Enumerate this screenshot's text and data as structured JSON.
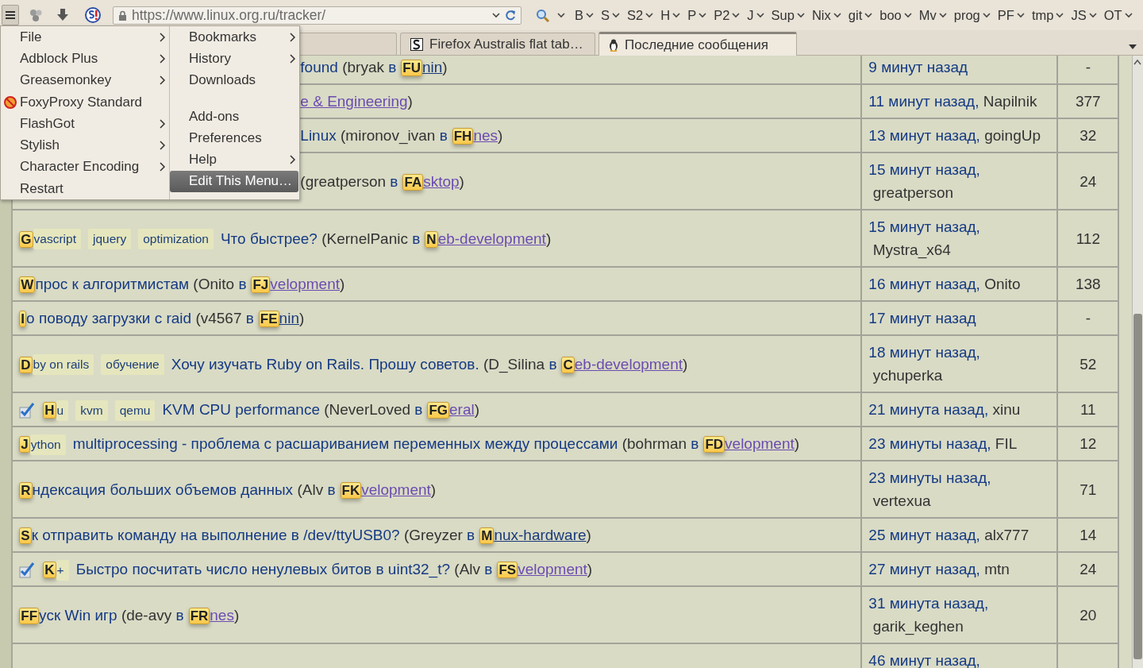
{
  "toolbar": {
    "url": "https://www.linux.org.ru/tracker/",
    "bookmarks": [
      "B",
      "S",
      "S2",
      "H",
      "P",
      "P2",
      "J",
      "Sup",
      "Nix",
      "git",
      "boo",
      "Mv",
      "prog",
      "PF",
      "tmp",
      "JS",
      "OT"
    ]
  },
  "tabs": [
    {
      "selected": false
    },
    {
      "label": "Firefox Australis flat tab…",
      "selected": false
    },
    {
      "label": "Последние сообщения",
      "selected": true
    }
  ],
  "menu": {
    "columns": [
      {
        "items": [
          {
            "kind": "plain",
            "label": "File",
            "submenu": true,
            "highlighted": false
          },
          {
            "kind": "plain",
            "label": "Adblock Plus",
            "submenu": true,
            "highlighted": false
          },
          {
            "kind": "plain",
            "label": "Greasemonkey",
            "submenu": true,
            "highlighted": false
          },
          {
            "kind": "iconic",
            "label": "FoxyProxy Standard",
            "submenu": false,
            "highlighted": false
          },
          {
            "kind": "plain",
            "label": "FlashGot",
            "submenu": true,
            "highlighted": false
          },
          {
            "kind": "plain",
            "label": "Stylish",
            "submenu": true,
            "highlighted": false
          },
          {
            "kind": "plain",
            "label": "Character Encoding",
            "submenu": true,
            "highlighted": false
          },
          {
            "kind": "plain",
            "label": "Restart",
            "submenu": false,
            "highlighted": false
          }
        ]
      },
      {
        "items": [
          {
            "kind": "plain",
            "label": "Bookmarks",
            "submenu": true,
            "highlighted": false
          },
          {
            "kind": "plain",
            "label": "History",
            "submenu": true,
            "highlighted": false
          },
          {
            "kind": "plain",
            "label": "Downloads",
            "submenu": false,
            "highlighted": false
          },
          {
            "kind": "gap"
          },
          {
            "kind": "plain",
            "label": "Add-ons",
            "submenu": false,
            "highlighted": false
          },
          {
            "kind": "plain",
            "label": "Preferences",
            "submenu": false,
            "highlighted": false
          },
          {
            "kind": "plain",
            "label": "Help",
            "submenu": true,
            "highlighted": false
          },
          {
            "kind": "plain",
            "label": "Edit This Menu…",
            "submenu": false,
            "highlighted": true
          }
        ]
      }
    ]
  },
  "table": {
    "rows": [
      {
        "checked": false,
        "parts": [
          {
            "kind": "topic",
            "text": "found"
          },
          {
            "kind": "text",
            "text": " (bryak "
          },
          {
            "kind": "in",
            "text": "в"
          },
          {
            "kind": "hint",
            "text": "FU"
          },
          {
            "kind": "section",
            "text": "nin",
            "visited": false
          },
          {
            "kind": "text",
            "text": ")"
          }
        ],
        "ago": "9 минут назад",
        "count": "-"
      },
      {
        "checked": false,
        "parts": [
          {
            "kind": "section",
            "text": "e & Engineering",
            "visited": true
          },
          {
            "kind": "text",
            "text": ")"
          }
        ],
        "ago": "11 минут назад,",
        "author": "Napilnik",
        "count": "377"
      },
      {
        "checked": false,
        "parts": [
          {
            "kind": "topic",
            "text": "Linux"
          },
          {
            "kind": "text",
            "text": " (mironov_ivan "
          },
          {
            "kind": "in",
            "text": "в"
          },
          {
            "kind": "hint",
            "text": "FH"
          },
          {
            "kind": "section",
            "text": "nes",
            "visited": true
          },
          {
            "kind": "text",
            "text": ")"
          }
        ],
        "ago": "13 минут назад,",
        "author": "goingUp",
        "count": "32"
      },
      {
        "checked": false,
        "parts": [
          {
            "kind": "text",
            "text": "(greatperson "
          },
          {
            "kind": "in",
            "text": "в"
          },
          {
            "kind": "hint",
            "text": "FA"
          },
          {
            "kind": "section",
            "text": "sktop",
            "visited": true
          },
          {
            "kind": "text",
            "text": ")"
          }
        ],
        "ago": "15 минут назад,",
        "author": "greatperson",
        "count": "24"
      },
      {
        "checked": false,
        "parts": [
          {
            "kind": "hint",
            "text": "G"
          },
          {
            "kind": "tag",
            "text": "vascript"
          },
          {
            "kind": "tag",
            "text": "jquery"
          },
          {
            "kind": "tag",
            "text": "optimization"
          },
          {
            "kind": "topic",
            "text": "Что быстрее?"
          },
          {
            "kind": "text",
            "text": " (KernelPanic "
          },
          {
            "kind": "in",
            "text": "в"
          },
          {
            "kind": "hint",
            "text": "N"
          },
          {
            "kind": "section",
            "text": "eb-development",
            "visited": true
          },
          {
            "kind": "text",
            "text": ")"
          }
        ],
        "ago": "15 минут назад,",
        "author": "Mystra_x64",
        "count": "112"
      },
      {
        "checked": false,
        "parts": [
          {
            "kind": "hint",
            "text": "W"
          },
          {
            "kind": "topic",
            "text": "прос к алгоритмистам"
          },
          {
            "kind": "text",
            "text": " (Onito "
          },
          {
            "kind": "in",
            "text": "в"
          },
          {
            "kind": "hint",
            "text": "FJ"
          },
          {
            "kind": "section",
            "text": "velopment",
            "visited": true
          },
          {
            "kind": "text",
            "text": ")"
          }
        ],
        "ago": "16 минут назад,",
        "author": "Onito",
        "count": "138"
      },
      {
        "checked": false,
        "parts": [
          {
            "kind": "hint",
            "text": "I"
          },
          {
            "kind": "topic",
            "text": "о поводу загрузки с raid"
          },
          {
            "kind": "text",
            "text": " (v4567 "
          },
          {
            "kind": "in",
            "text": "в"
          },
          {
            "kind": "hint",
            "text": "FE"
          },
          {
            "kind": "section",
            "text": "nin",
            "visited": false
          },
          {
            "kind": "text",
            "text": ")"
          }
        ],
        "ago": "17 минут назад",
        "count": "-"
      },
      {
        "checked": false,
        "parts": [
          {
            "kind": "hint",
            "text": "D"
          },
          {
            "kind": "tag",
            "text": "by on rails"
          },
          {
            "kind": "tag",
            "text": "обучение"
          },
          {
            "kind": "topic",
            "text": "Хочу изучать Ruby on Rails. Прошу советов."
          },
          {
            "kind": "text",
            "text": " (D_Silina "
          },
          {
            "kind": "in",
            "text": "в"
          },
          {
            "kind": "hint",
            "text": "C"
          },
          {
            "kind": "section",
            "text": "eb-development",
            "visited": true
          },
          {
            "kind": "text",
            "text": ")"
          }
        ],
        "ago": "18 минут назад,",
        "author": "ychuperka",
        "count": "52"
      },
      {
        "checked": true,
        "parts": [
          {
            "kind": "hint",
            "text": "H"
          },
          {
            "kind": "tag",
            "text": "u"
          },
          {
            "kind": "tag",
            "text": "kvm"
          },
          {
            "kind": "tag",
            "text": "qemu"
          },
          {
            "kind": "topic",
            "text": "KVM CPU performance"
          },
          {
            "kind": "text",
            "text": " (NeverLoved "
          },
          {
            "kind": "in",
            "text": "в"
          },
          {
            "kind": "hint",
            "text": "FG"
          },
          {
            "kind": "section",
            "text": "eral",
            "visited": true
          },
          {
            "kind": "text",
            "text": ")"
          }
        ],
        "ago": "21 минута назад,",
        "author": "xinu",
        "count": "11"
      },
      {
        "checked": false,
        "parts": [
          {
            "kind": "hint",
            "text": "J"
          },
          {
            "kind": "tag",
            "text": "ython"
          },
          {
            "kind": "topic",
            "text": "multiprocessing - проблема с расшариванием переменных между процессами"
          },
          {
            "kind": "text",
            "text": " (bohrman "
          },
          {
            "kind": "in",
            "text": "в"
          },
          {
            "kind": "hint",
            "text": "FD"
          },
          {
            "kind": "section",
            "text": "velopment",
            "visited": true
          },
          {
            "kind": "text",
            "text": ")"
          }
        ],
        "ago": "23 минуты назад,",
        "author": "FIL",
        "count": "12"
      },
      {
        "checked": false,
        "parts": [
          {
            "kind": "hint",
            "text": "R"
          },
          {
            "kind": "topic",
            "text": "ндексация больших объемов данных"
          },
          {
            "kind": "text",
            "text": " (Alv "
          },
          {
            "kind": "in",
            "text": "в"
          },
          {
            "kind": "hint",
            "text": "FK"
          },
          {
            "kind": "section",
            "text": "velopment",
            "visited": true
          },
          {
            "kind": "text",
            "text": ")"
          }
        ],
        "ago": "23 минуты назад,",
        "author": "vertexua",
        "count": "71"
      },
      {
        "checked": false,
        "parts": [
          {
            "kind": "hint",
            "text": "S"
          },
          {
            "kind": "topic",
            "text": "к отправить команду на выполнение в /dev/ttyUSB0?"
          },
          {
            "kind": "text",
            "text": " (Greyzer "
          },
          {
            "kind": "in",
            "text": "в"
          },
          {
            "kind": "hint",
            "text": "M"
          },
          {
            "kind": "section",
            "text": "nux-hardware",
            "visited": false
          },
          {
            "kind": "text",
            "text": ")"
          }
        ],
        "ago": "25 минут назад,",
        "author": "alx777",
        "count": "14"
      },
      {
        "checked": true,
        "parts": [
          {
            "kind": "hint",
            "text": "K"
          },
          {
            "kind": "tag",
            "text": "+"
          },
          {
            "kind": "topic",
            "text": "Быстро посчитать число ненулевых битов в uint32_t?"
          },
          {
            "kind": "text",
            "text": " (Alv "
          },
          {
            "kind": "in",
            "text": "в"
          },
          {
            "kind": "hint",
            "text": "FS"
          },
          {
            "kind": "section",
            "text": "velopment",
            "visited": true
          },
          {
            "kind": "text",
            "text": ")"
          }
        ],
        "ago": "27 минут назад,",
        "author": "mtn",
        "count": "24"
      },
      {
        "checked": false,
        "parts": [
          {
            "kind": "hint",
            "text": "FF"
          },
          {
            "kind": "topic",
            "text": "уск Win игр"
          },
          {
            "kind": "text",
            "text": " (de-avy "
          },
          {
            "kind": "in",
            "text": "в"
          },
          {
            "kind": "hint",
            "text": "FR"
          },
          {
            "kind": "section",
            "text": "nes",
            "visited": true
          },
          {
            "kind": "text",
            "text": ")"
          }
        ],
        "ago": "31 минута назад,",
        "author": "garik_keghen",
        "count": "20"
      },
      {
        "checked": false,
        "parts": [],
        "ago": "46 минут назад,"
      }
    ]
  }
}
